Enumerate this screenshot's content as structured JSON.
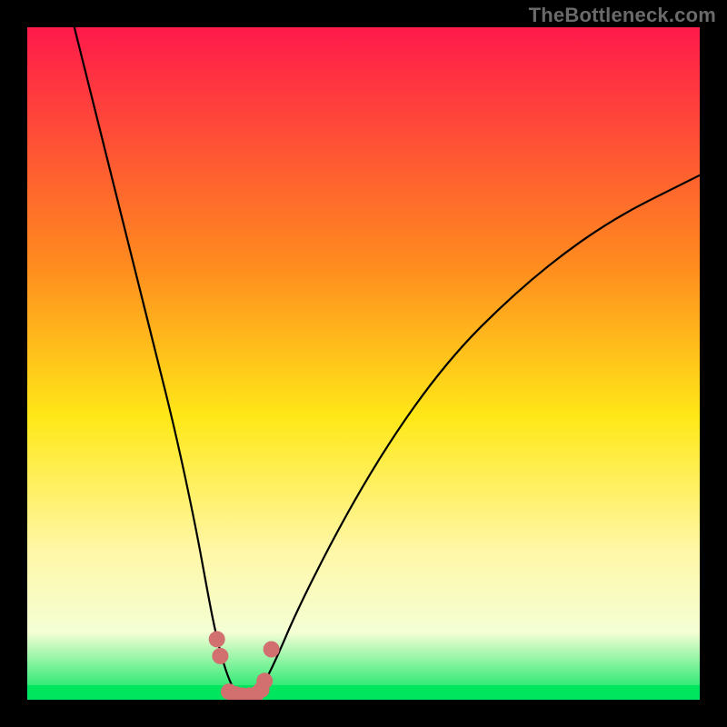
{
  "attribution": "TheBottleneck.com",
  "colors": {
    "frame": "#000000",
    "curve": "#000000",
    "markers": "#d27070",
    "green_band": "#00e55e",
    "gradient_top": "#ff1a4b",
    "gradient_mid_upper": "#ff8a1f",
    "gradient_mid": "#ffe818",
    "gradient_mid_lower": "#fff7a8",
    "gradient_lower": "#f4ffd4"
  },
  "chart_data": {
    "type": "line",
    "title": "",
    "xlabel": "",
    "ylabel": "",
    "xlim": [
      0,
      100
    ],
    "ylim": [
      0,
      100
    ],
    "annotations": [],
    "series": [
      {
        "name": "bottleneck-curve",
        "x": [
          7,
          10,
          13,
          16,
          19,
          22,
          25,
          27,
          28,
          29,
          30,
          31,
          32,
          33,
          34,
          35,
          37,
          40,
          45,
          50,
          55,
          60,
          65,
          70,
          75,
          80,
          85,
          90,
          95,
          100
        ],
        "y": [
          100,
          88,
          76,
          64,
          52,
          40,
          26,
          15,
          10,
          6,
          3,
          1,
          0.5,
          0.5,
          0.8,
          2,
          6,
          13,
          23,
          32,
          40,
          47,
          53,
          58,
          62.5,
          66.5,
          70,
          73,
          75.5,
          78
        ]
      }
    ],
    "markers": {
      "name": "highlight-points",
      "x": [
        28.2,
        28.7,
        30.0,
        31.0,
        32.0,
        33.0,
        34.0,
        34.8,
        35.3,
        36.3
      ],
      "y": [
        9.0,
        6.5,
        1.2,
        0.8,
        0.6,
        0.6,
        0.8,
        1.5,
        2.8,
        7.5
      ]
    }
  }
}
